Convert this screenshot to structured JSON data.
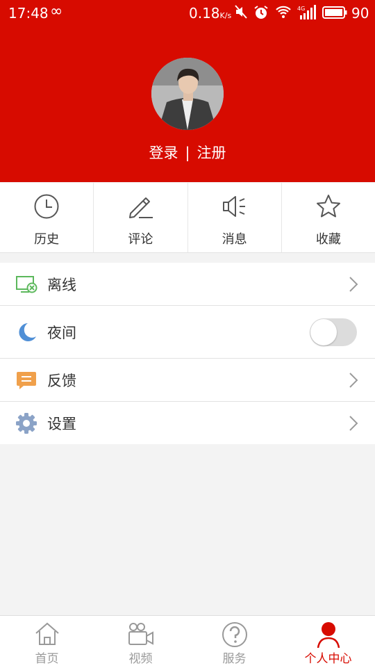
{
  "status_bar": {
    "time": "17:48",
    "speed": "0.18",
    "speed_unit": "K/s",
    "battery": "90"
  },
  "profile": {
    "login_label": "登录",
    "separator": "|",
    "register_label": "注册"
  },
  "quick_actions": [
    {
      "label": "历史",
      "icon": "clock-icon"
    },
    {
      "label": "评论",
      "icon": "pen-icon"
    },
    {
      "label": "消息",
      "icon": "speaker-icon"
    },
    {
      "label": "收藏",
      "icon": "star-icon"
    }
  ],
  "menu": [
    {
      "label": "离线",
      "icon": "offline-screen-icon",
      "control": "chevron"
    },
    {
      "label": "夜间",
      "icon": "moon-icon",
      "control": "toggle",
      "toggle_on": false
    },
    {
      "label": "反馈",
      "icon": "feedback-icon",
      "control": "chevron"
    },
    {
      "label": "设置",
      "icon": "gear-icon",
      "control": "chevron"
    }
  ],
  "tabbar": [
    {
      "label": "首页",
      "icon": "home-icon",
      "active": false
    },
    {
      "label": "视频",
      "icon": "video-camera-icon",
      "active": false
    },
    {
      "label": "服务",
      "icon": "help-circle-icon",
      "active": false
    },
    {
      "label": "个人中心",
      "icon": "user-icon",
      "active": true
    }
  ],
  "colors": {
    "brand": "#d70b00",
    "background": "#f3f3f3",
    "offline_icon": "#5cb85c",
    "moon_icon": "#4f8fd6",
    "feedback_icon": "#f0a04b",
    "gear_icon": "#8ba3c7"
  }
}
